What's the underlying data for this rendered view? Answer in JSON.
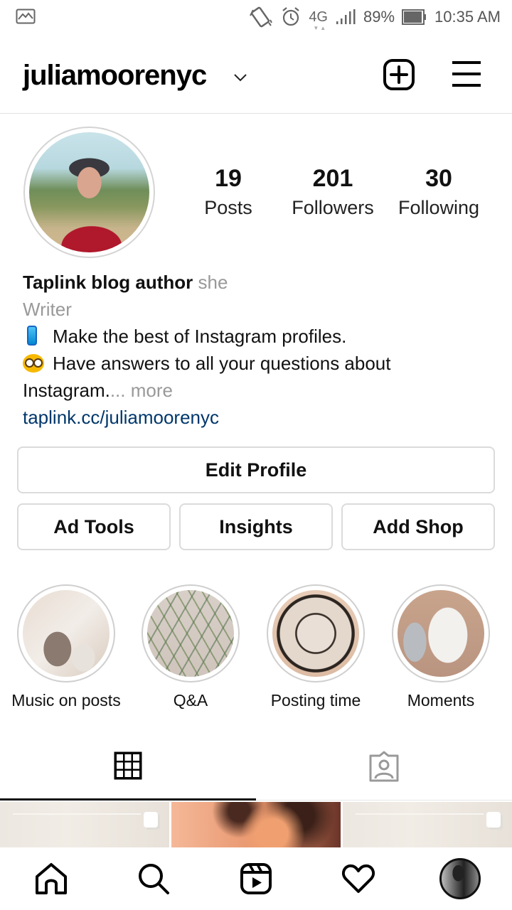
{
  "status_bar": {
    "network": "4G",
    "battery": "89%",
    "time": "10:35 AM",
    "icons": [
      "gallery-icon",
      "vibrate-icon",
      "alarm-icon",
      "signal-icon",
      "battery-icon"
    ]
  },
  "header": {
    "username": "juliamoorenyc",
    "icons": [
      "chevron-down-icon",
      "add-post-icon",
      "menu-icon"
    ]
  },
  "profile": {
    "stats": [
      {
        "count": "19",
        "label": "Posts"
      },
      {
        "count": "201",
        "label": "Followers"
      },
      {
        "count": "30",
        "label": "Following"
      }
    ],
    "bio": {
      "name": "Taplink blog author",
      "pronouns": "she",
      "category": "Writer",
      "line1": "Make the best of Instagram profiles.",
      "line2": "Have answers to all your questions about",
      "line3": "Instagram.",
      "more": "... more",
      "link": "taplink.cc/juliamoorenyc"
    }
  },
  "buttons": {
    "edit_profile": "Edit Profile",
    "ad_tools": "Ad Tools",
    "insights": "Insights",
    "add_shop": "Add Shop"
  },
  "highlights": [
    {
      "label": "Music on posts"
    },
    {
      "label": "Q&A"
    },
    {
      "label": "Posting time"
    },
    {
      "label": "Moments"
    }
  ],
  "tabs": [
    {
      "name": "grid",
      "icon": "grid-icon",
      "active": true
    },
    {
      "name": "tagged",
      "icon": "tagged-person-icon",
      "active": false
    }
  ],
  "bottom_nav": [
    {
      "name": "home",
      "icon": "home-icon"
    },
    {
      "name": "search",
      "icon": "search-icon"
    },
    {
      "name": "reels",
      "icon": "reels-icon"
    },
    {
      "name": "activity",
      "icon": "heart-icon"
    },
    {
      "name": "profile",
      "icon": "profile-avatar"
    }
  ],
  "colors": {
    "link": "#00376b",
    "muted": "#999999",
    "border": "#dbdbdb",
    "text": "#111111"
  }
}
